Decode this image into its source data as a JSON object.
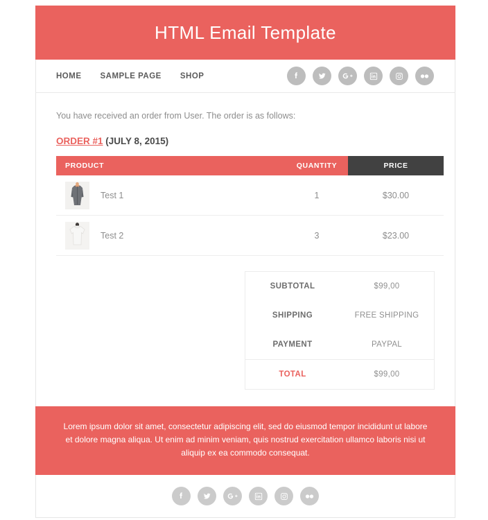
{
  "header": {
    "title": "HTML Email Template",
    "background_color": "#ea625e"
  },
  "nav": {
    "links": [
      {
        "label": "HOME"
      },
      {
        "label": "SAMPLE PAGE"
      },
      {
        "label": "SHOP"
      }
    ],
    "social": [
      {
        "name": "facebook-icon",
        "label": "Facebook"
      },
      {
        "name": "twitter-icon",
        "label": "Twitter"
      },
      {
        "name": "google-plus-icon",
        "label": "Google Plus"
      },
      {
        "name": "linkedin-icon",
        "label": "LinkedIn"
      },
      {
        "name": "instagram-icon",
        "label": "Instagram"
      },
      {
        "name": "flickr-icon",
        "label": "Flickr"
      }
    ]
  },
  "body": {
    "intro": "You have received an order from User. The order is as follows:",
    "order_link": "ORDER #1",
    "order_date": " (JULY 8, 2015)",
    "table": {
      "columns": [
        "PRODUCT",
        "QUANTITY",
        "PRICE"
      ],
      "rows": [
        {
          "product": "Test 1",
          "quantity": "1",
          "price": "$30.00",
          "thumb": "gray-coat-photo"
        },
        {
          "product": "Test 2",
          "quantity": "3",
          "price": "$23.00",
          "thumb": "white-tshirt-photo"
        }
      ]
    },
    "totals": [
      {
        "label": "SUBTOTAL",
        "value": "$99,00",
        "accent": false
      },
      {
        "label": "SHIPPING",
        "value": "FREE SHIPPING",
        "accent": false
      },
      {
        "label": "PAYMENT",
        "value": "PAYPAL",
        "accent": false
      },
      {
        "label": "TOTAL",
        "value": "$99,00",
        "accent": true
      }
    ]
  },
  "footer": {
    "text": "Lorem ipsum dolor sit amet, consectetur adipiscing elit, sed do eiusmod tempor incididunt ut labore et dolore magna aliqua. Ut enim ad minim veniam, quis nostrud exercitation ullamco laboris nisi ut aliquip ex ea commodo consequat.",
    "social": [
      {
        "name": "facebook-icon",
        "label": "Facebook"
      },
      {
        "name": "twitter-icon",
        "label": "Twitter"
      },
      {
        "name": "google-plus-icon",
        "label": "Google Plus"
      },
      {
        "name": "linkedin-icon",
        "label": "LinkedIn"
      },
      {
        "name": "instagram-icon",
        "label": "Instagram"
      },
      {
        "name": "flickr-icon",
        "label": "Flickr"
      }
    ]
  },
  "colors": {
    "accent": "#ea625e",
    "dark": "#414141",
    "muted_text": "#8d8d8d",
    "social_icon": "#bdbdbd"
  }
}
